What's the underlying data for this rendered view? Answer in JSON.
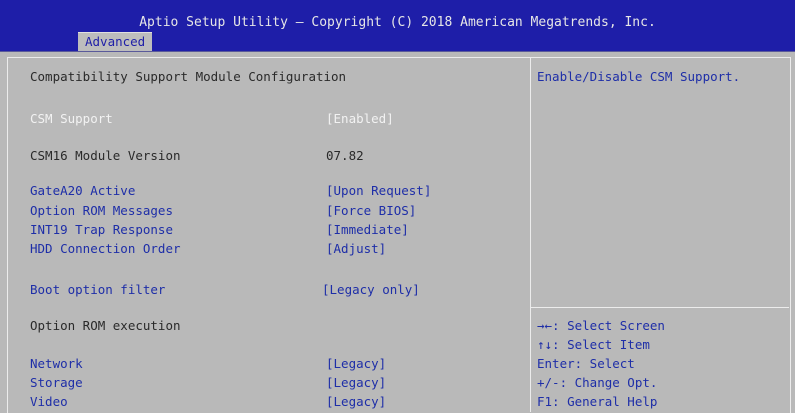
{
  "header": {
    "title": "Aptio Setup Utility – Copyright (C) 2018 American Megatrends, Inc.",
    "active_tab": "Advanced"
  },
  "main": {
    "section_title": "Compatibility Support Module Configuration",
    "csm_support": {
      "label": "CSM Support",
      "value": "[Enabled]"
    },
    "csm16_version": {
      "label": "CSM16 Module Version",
      "value": "07.82"
    },
    "settings": [
      {
        "label": "GateA20 Active",
        "value": "[Upon Request]"
      },
      {
        "label": "Option ROM Messages",
        "value": "[Force BIOS]"
      },
      {
        "label": "INT19 Trap Response",
        "value": "[Immediate]"
      },
      {
        "label": "HDD Connection Order",
        "value": "[Adjust]"
      }
    ],
    "boot_filter": {
      "label": "Boot option filter",
      "value": "[Legacy only]"
    },
    "option_rom_heading": "Option ROM execution",
    "rom_items": [
      {
        "label": "Network",
        "value": "[Legacy]"
      },
      {
        "label": "Storage",
        "value": "[Legacy]"
      },
      {
        "label": "Video",
        "value": "[Legacy]"
      }
    ]
  },
  "help": {
    "description": "Enable/Disable CSM Support.",
    "keys": [
      "→←: Select Screen",
      "↑↓: Select Item",
      "Enter: Select",
      "+/-: Change Opt.",
      "F1: General Help"
    ]
  },
  "colors": {
    "header_bg": "#1e1ea8",
    "body_bg": "#b9b9b9",
    "selected_text": "#f2f2f2",
    "option_text": "#1e2ea8"
  }
}
